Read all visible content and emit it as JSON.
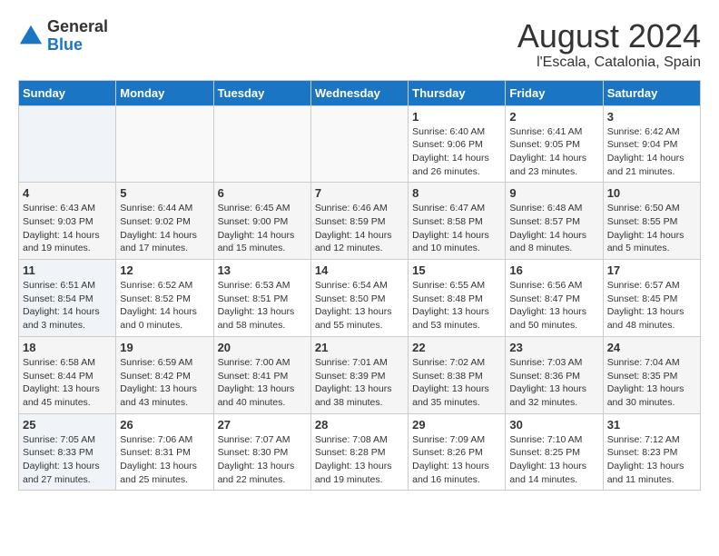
{
  "header": {
    "logo_line1": "General",
    "logo_line2": "Blue",
    "title": "August 2024",
    "subtitle": "l'Escala, Catalonia, Spain"
  },
  "days_of_week": [
    "Sunday",
    "Monday",
    "Tuesday",
    "Wednesday",
    "Thursday",
    "Friday",
    "Saturday"
  ],
  "weeks": [
    {
      "days": [
        {
          "number": "",
          "info": ""
        },
        {
          "number": "",
          "info": ""
        },
        {
          "number": "",
          "info": ""
        },
        {
          "number": "",
          "info": ""
        },
        {
          "number": "1",
          "info": "Sunrise: 6:40 AM\nSunset: 9:06 PM\nDaylight: 14 hours\nand 26 minutes."
        },
        {
          "number": "2",
          "info": "Sunrise: 6:41 AM\nSunset: 9:05 PM\nDaylight: 14 hours\nand 23 minutes."
        },
        {
          "number": "3",
          "info": "Sunrise: 6:42 AM\nSunset: 9:04 PM\nDaylight: 14 hours\nand 21 minutes."
        }
      ]
    },
    {
      "days": [
        {
          "number": "4",
          "info": "Sunrise: 6:43 AM\nSunset: 9:03 PM\nDaylight: 14 hours\nand 19 minutes."
        },
        {
          "number": "5",
          "info": "Sunrise: 6:44 AM\nSunset: 9:02 PM\nDaylight: 14 hours\nand 17 minutes."
        },
        {
          "number": "6",
          "info": "Sunrise: 6:45 AM\nSunset: 9:00 PM\nDaylight: 14 hours\nand 15 minutes."
        },
        {
          "number": "7",
          "info": "Sunrise: 6:46 AM\nSunset: 8:59 PM\nDaylight: 14 hours\nand 12 minutes."
        },
        {
          "number": "8",
          "info": "Sunrise: 6:47 AM\nSunset: 8:58 PM\nDaylight: 14 hours\nand 10 minutes."
        },
        {
          "number": "9",
          "info": "Sunrise: 6:48 AM\nSunset: 8:57 PM\nDaylight: 14 hours\nand 8 minutes."
        },
        {
          "number": "10",
          "info": "Sunrise: 6:50 AM\nSunset: 8:55 PM\nDaylight: 14 hours\nand 5 minutes."
        }
      ]
    },
    {
      "days": [
        {
          "number": "11",
          "info": "Sunrise: 6:51 AM\nSunset: 8:54 PM\nDaylight: 14 hours\nand 3 minutes."
        },
        {
          "number": "12",
          "info": "Sunrise: 6:52 AM\nSunset: 8:52 PM\nDaylight: 14 hours\nand 0 minutes."
        },
        {
          "number": "13",
          "info": "Sunrise: 6:53 AM\nSunset: 8:51 PM\nDaylight: 13 hours\nand 58 minutes."
        },
        {
          "number": "14",
          "info": "Sunrise: 6:54 AM\nSunset: 8:50 PM\nDaylight: 13 hours\nand 55 minutes."
        },
        {
          "number": "15",
          "info": "Sunrise: 6:55 AM\nSunset: 8:48 PM\nDaylight: 13 hours\nand 53 minutes."
        },
        {
          "number": "16",
          "info": "Sunrise: 6:56 AM\nSunset: 8:47 PM\nDaylight: 13 hours\nand 50 minutes."
        },
        {
          "number": "17",
          "info": "Sunrise: 6:57 AM\nSunset: 8:45 PM\nDaylight: 13 hours\nand 48 minutes."
        }
      ]
    },
    {
      "days": [
        {
          "number": "18",
          "info": "Sunrise: 6:58 AM\nSunset: 8:44 PM\nDaylight: 13 hours\nand 45 minutes."
        },
        {
          "number": "19",
          "info": "Sunrise: 6:59 AM\nSunset: 8:42 PM\nDaylight: 13 hours\nand 43 minutes."
        },
        {
          "number": "20",
          "info": "Sunrise: 7:00 AM\nSunset: 8:41 PM\nDaylight: 13 hours\nand 40 minutes."
        },
        {
          "number": "21",
          "info": "Sunrise: 7:01 AM\nSunset: 8:39 PM\nDaylight: 13 hours\nand 38 minutes."
        },
        {
          "number": "22",
          "info": "Sunrise: 7:02 AM\nSunset: 8:38 PM\nDaylight: 13 hours\nand 35 minutes."
        },
        {
          "number": "23",
          "info": "Sunrise: 7:03 AM\nSunset: 8:36 PM\nDaylight: 13 hours\nand 32 minutes."
        },
        {
          "number": "24",
          "info": "Sunrise: 7:04 AM\nSunset: 8:35 PM\nDaylight: 13 hours\nand 30 minutes."
        }
      ]
    },
    {
      "days": [
        {
          "number": "25",
          "info": "Sunrise: 7:05 AM\nSunset: 8:33 PM\nDaylight: 13 hours\nand 27 minutes."
        },
        {
          "number": "26",
          "info": "Sunrise: 7:06 AM\nSunset: 8:31 PM\nDaylight: 13 hours\nand 25 minutes."
        },
        {
          "number": "27",
          "info": "Sunrise: 7:07 AM\nSunset: 8:30 PM\nDaylight: 13 hours\nand 22 minutes."
        },
        {
          "number": "28",
          "info": "Sunrise: 7:08 AM\nSunset: 8:28 PM\nDaylight: 13 hours\nand 19 minutes."
        },
        {
          "number": "29",
          "info": "Sunrise: 7:09 AM\nSunset: 8:26 PM\nDaylight: 13 hours\nand 16 minutes."
        },
        {
          "number": "30",
          "info": "Sunrise: 7:10 AM\nSunset: 8:25 PM\nDaylight: 13 hours\nand 14 minutes."
        },
        {
          "number": "31",
          "info": "Sunrise: 7:12 AM\nSunset: 8:23 PM\nDaylight: 13 hours\nand 11 minutes."
        }
      ]
    }
  ]
}
